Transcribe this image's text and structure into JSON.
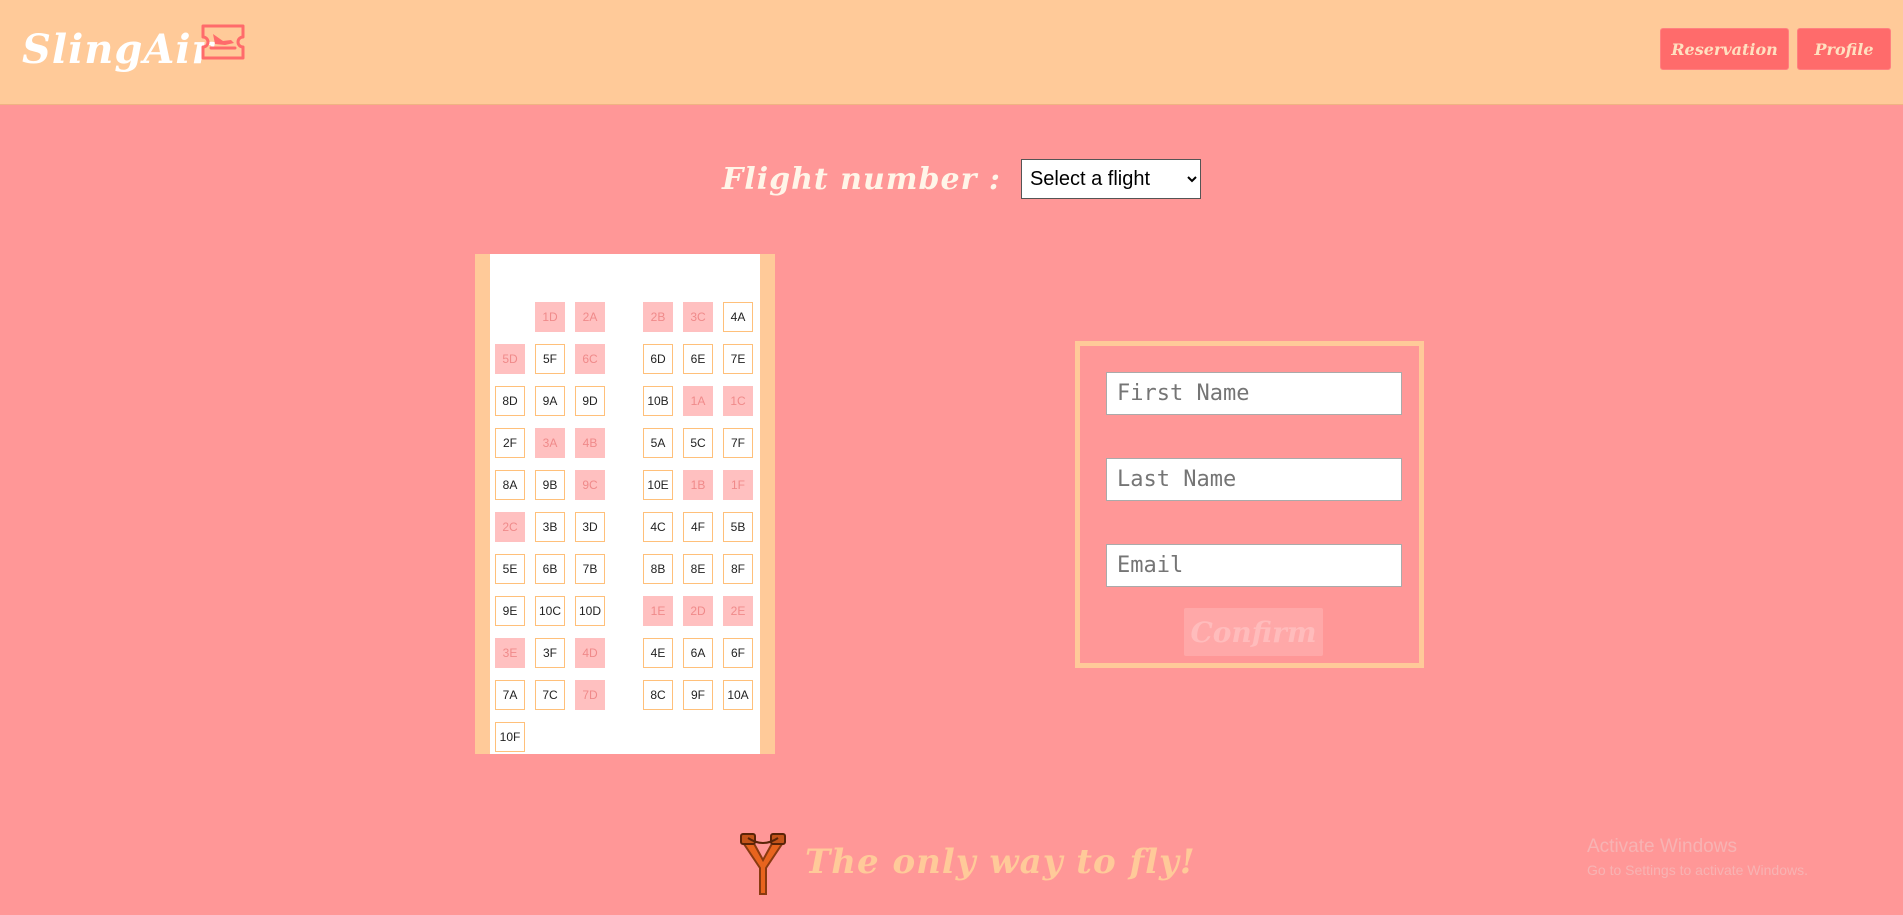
{
  "header": {
    "logo_text": "SlingAir",
    "logo_icon": "plane-ticket-icon",
    "nav": [
      "Reservation",
      "Profile"
    ]
  },
  "flight": {
    "label": "Flight number :",
    "select_value": "Select a flight"
  },
  "seats": [
    {
      "id": "1D",
      "taken": true
    },
    {
      "id": "2A",
      "taken": true
    },
    {
      "id": "2B",
      "taken": true
    },
    {
      "id": "3C",
      "taken": true
    },
    {
      "id": "4A",
      "taken": false
    },
    {
      "id": "5D",
      "taken": true
    },
    {
      "id": "5F",
      "taken": false
    },
    {
      "id": "6C",
      "taken": true
    },
    {
      "id": "6D",
      "taken": false
    },
    {
      "id": "6E",
      "taken": false
    },
    {
      "id": "7E",
      "taken": false
    },
    {
      "id": "8D",
      "taken": false
    },
    {
      "id": "9A",
      "taken": false
    },
    {
      "id": "9D",
      "taken": false
    },
    {
      "id": "10B",
      "taken": false
    },
    {
      "id": "1A",
      "taken": true
    },
    {
      "id": "1C",
      "taken": true
    },
    {
      "id": "2F",
      "taken": false
    },
    {
      "id": "3A",
      "taken": true
    },
    {
      "id": "4B",
      "taken": true
    },
    {
      "id": "5A",
      "taken": false
    },
    {
      "id": "5C",
      "taken": false
    },
    {
      "id": "7F",
      "taken": false
    },
    {
      "id": "8A",
      "taken": false
    },
    {
      "id": "9B",
      "taken": false
    },
    {
      "id": "9C",
      "taken": true
    },
    {
      "id": "10E",
      "taken": false
    },
    {
      "id": "1B",
      "taken": true
    },
    {
      "id": "1F",
      "taken": true
    },
    {
      "id": "2C",
      "taken": true
    },
    {
      "id": "3B",
      "taken": false
    },
    {
      "id": "3D",
      "taken": false
    },
    {
      "id": "4C",
      "taken": false
    },
    {
      "id": "4F",
      "taken": false
    },
    {
      "id": "5B",
      "taken": false
    },
    {
      "id": "5E",
      "taken": false
    },
    {
      "id": "6B",
      "taken": false
    },
    {
      "id": "7B",
      "taken": false
    },
    {
      "id": "8B",
      "taken": false
    },
    {
      "id": "8E",
      "taken": false
    },
    {
      "id": "8F",
      "taken": false
    },
    {
      "id": "9E",
      "taken": false
    },
    {
      "id": "10C",
      "taken": false
    },
    {
      "id": "10D",
      "taken": false
    },
    {
      "id": "1E",
      "taken": true
    },
    {
      "id": "2D",
      "taken": true
    },
    {
      "id": "2E",
      "taken": true
    },
    {
      "id": "3E",
      "taken": true
    },
    {
      "id": "3F",
      "taken": false
    },
    {
      "id": "4D",
      "taken": true
    },
    {
      "id": "4E",
      "taken": false
    },
    {
      "id": "6A",
      "taken": false
    },
    {
      "id": "6F",
      "taken": false
    },
    {
      "id": "7A",
      "taken": false
    },
    {
      "id": "7C",
      "taken": false
    },
    {
      "id": "7D",
      "taken": true
    },
    {
      "id": "8C",
      "taken": false
    },
    {
      "id": "9F",
      "taken": false
    },
    {
      "id": "10A",
      "taken": false
    },
    {
      "id": "10F",
      "taken": false
    }
  ],
  "form": {
    "first_name_placeholder": "First Name",
    "last_name_placeholder": "Last Name",
    "email_placeholder": "Email",
    "confirm_label": "Confirm"
  },
  "footer": {
    "tagline": "The only way to fly!",
    "icon": "slingshot-icon"
  },
  "watermark": {
    "title": "Activate Windows",
    "subtitle": "Go to Settings to activate Windows."
  },
  "colors": {
    "background": "#ff9797",
    "header": "#ffca99",
    "accent": "#ff6b6b",
    "seat_taken": "#ffc0c0",
    "seat_border": "#ffc07a"
  }
}
